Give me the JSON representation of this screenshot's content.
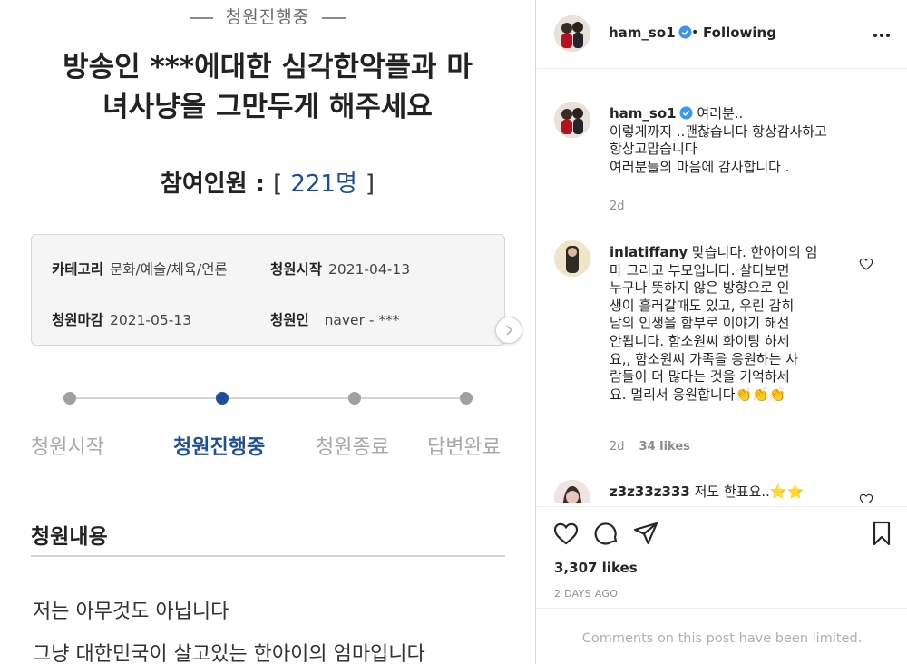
{
  "petition": {
    "status_banner": "청원진행중",
    "title_line1": "방송인 ***에대한 심각한악플과 마",
    "title_line2": "녀사냥을 그만두게 해주세요",
    "participants_label": "참여인원 : ",
    "participants_open": "[",
    "participants_count": "221명",
    "participants_close": "]",
    "info": {
      "category_label": "카테고리",
      "category_value": "문화/예술/체육/언론",
      "start_label": "청원시작",
      "start_value": "2021-04-13",
      "end_label": "청원마감",
      "end_value": "2021-05-13",
      "petitioner_label": "청원인",
      "petitioner_value": "naver - ***"
    },
    "steps": [
      "청원시작",
      "청원진행중",
      "청원종료",
      "답변완료"
    ],
    "active_step_index": 1,
    "content_heading": "청원내용",
    "content_lines": [
      "저는 아무것도 아닙니다",
      "그냥 대한민국이 살고있는 한아이의 엄마입니다"
    ]
  },
  "instagram": {
    "header": {
      "username": "ham_so1",
      "separator": "•",
      "follow_status": "Following"
    },
    "caption": {
      "username": "ham_so1",
      "text": "여러분.. 이렇게까지 ..괜찮습니다 항상감사하고 항상고맙습니다 여러분들의 마음에 감사합니다 .",
      "lines": [
        "여러분..",
        "이렇게까지 ..괜찮습니다 항상감사하고",
        "항상고맙습니다",
        "여러분들의 마음에 감사합니다 ."
      ],
      "time": "2d"
    },
    "comments": [
      {
        "username": "inlatiffany",
        "text": "맞습니다. 한아이의 엄마 그리고 부모입니다. 살다보면 누구나 뜻하지 않은 방향으로 인생이 흘러갈때도 있고, 우린 감히 남의 인생을 함부로 이야기 해선 안됩니다. 함소원씨 화이팅 하세요,, 함소원씨 가족을 응원하는 사람들이 더 많다는 것을 기억하세요. 멀리서 응원합니다👏👏👏",
        "lines": [
          "맞습니다. 한아이의 엄",
          "마 그리고 부모입니다. 살다보면",
          "누구나 뜻하지 않은 방향으로 인",
          "생이 흘러갈때도 있고, 우린 감히",
          "남의 인생을 함부로 이야기 해선",
          "안됩니다. 함소원씨 화이팅 하세",
          "요,, 함소원씨 가족을 응원하는 사",
          "람들이 더 많다는 것을 기억하세",
          "요. 멀리서 응원합니다👏👏👏"
        ],
        "time": "2d",
        "likes": "34 likes"
      },
      {
        "username": "z3z33z333",
        "text": "저도 한표요..⭐⭐",
        "lines": [
          "저도 한표요..⭐⭐"
        ]
      }
    ],
    "likes_count": "3,307 likes",
    "posted_ago": "2 DAYS AGO",
    "comments_notice": "Comments on this post have been limited.",
    "icons": {
      "like": "heart-icon",
      "comment": "comment-icon",
      "share": "share-icon",
      "save": "bookmark-icon",
      "more": "more-options-icon",
      "verified": "verified-badge-icon"
    },
    "colors": {
      "verified": "#3897f0",
      "petition_accent": "#1d4e9c"
    }
  }
}
